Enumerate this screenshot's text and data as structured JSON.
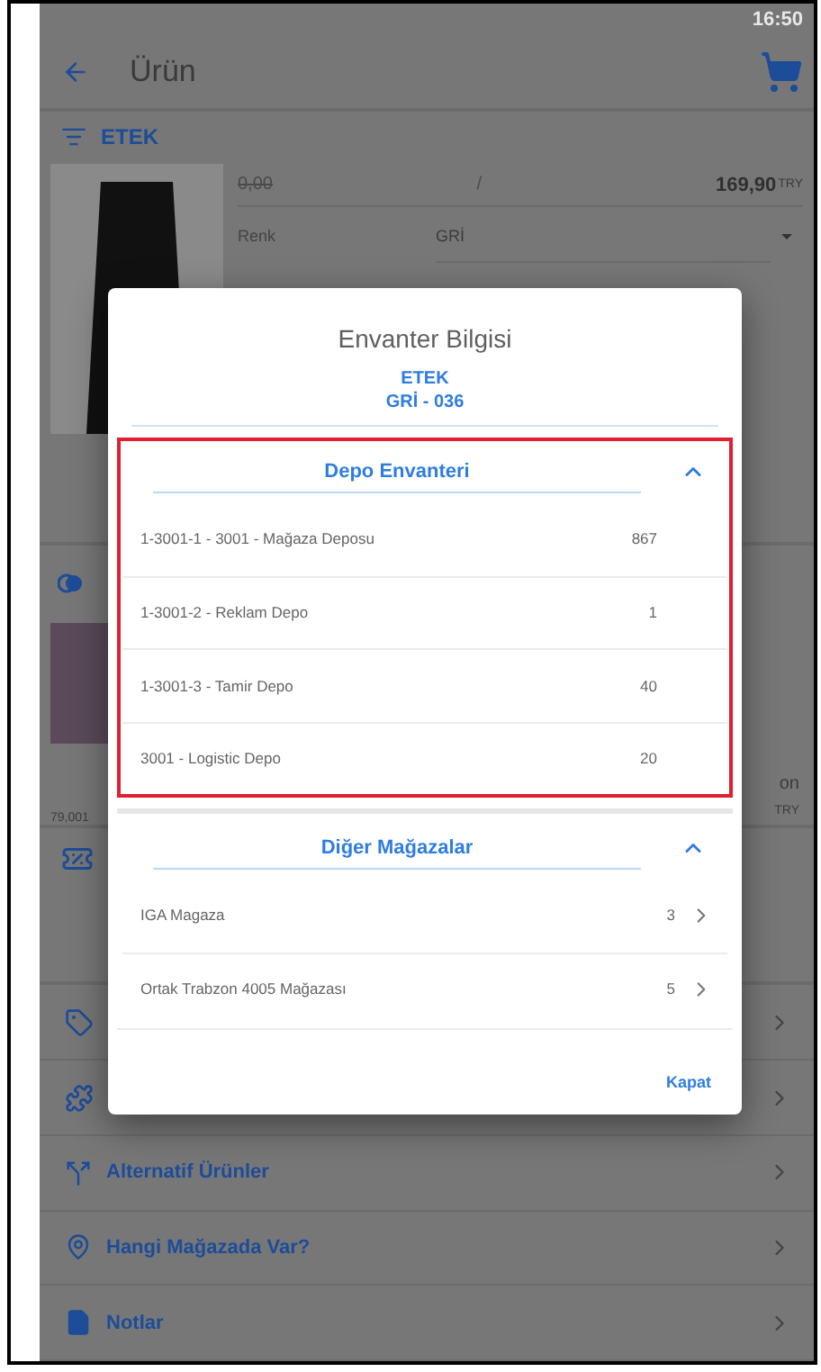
{
  "status_bar": {
    "time": "16:50"
  },
  "app_bar": {
    "title": "Ürün"
  },
  "product": {
    "category": "ETEK",
    "old_price": "0,00",
    "separator": "/",
    "price": "169,90",
    "currency": "TRY",
    "color_label": "Renk",
    "color_value": "GRİ"
  },
  "carousel": {
    "price": "79,001",
    "name_end": "on",
    "currency": "TRY"
  },
  "menu": [
    {
      "label": "Alternatif Ürünler"
    },
    {
      "label": "Hangi Mağazada Var?"
    },
    {
      "label": "Notlar"
    }
  ],
  "dialog": {
    "title": "Envanter Bilgisi",
    "product": "ETEK",
    "variant": "GRİ - 036",
    "sections": [
      {
        "title": "Depo Envanteri",
        "expanded": true,
        "highlighted": true,
        "rows": [
          {
            "name": "1-3001-1 - 3001 - Mağaza Deposu",
            "count": "867",
            "has_detail": false
          },
          {
            "name": "1-3001-2 - Reklam Depo",
            "count": "1",
            "has_detail": false
          },
          {
            "name": "1-3001-3 - Tamir Depo",
            "count": "40",
            "has_detail": false
          },
          {
            "name": "3001 - Logistic Depo",
            "count": "20",
            "has_detail": false
          }
        ]
      },
      {
        "title": "Diğer Mağazalar",
        "expanded": true,
        "highlighted": false,
        "rows": [
          {
            "name": "IGA Magaza",
            "count": "3",
            "has_detail": true
          },
          {
            "name": "Ortak Trabzon 4005 Mağazası",
            "count": "5",
            "has_detail": true
          }
        ]
      }
    ],
    "close_button": "Kapat"
  }
}
